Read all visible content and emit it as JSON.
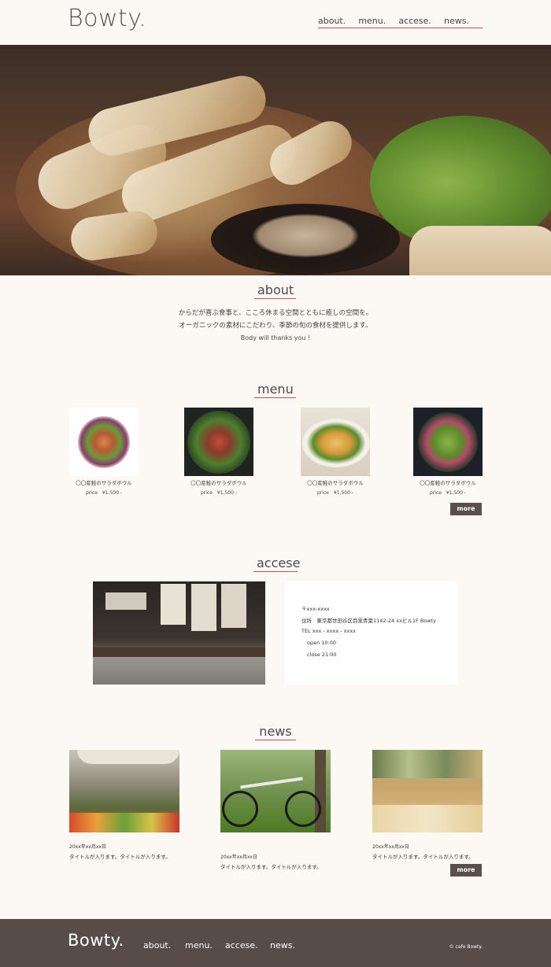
{
  "header": {
    "logo": "Bowty.",
    "nav": [
      "about.",
      "menu.",
      "accese.",
      "news."
    ]
  },
  "hero": {
    "alt": "Grilled shrimp platter with dip and salad"
  },
  "about": {
    "title": "about",
    "line1": "からだが喜ぶ食事と、こころ休まる空間とともに癒しの空間を。",
    "line2": "オーガニックの素材にこだわり、季節の旬の食材を提供します。",
    "line3": "Body will thanks you !"
  },
  "menu": {
    "title": "menu",
    "items": [
      {
        "name": "〇〇産鮭のサラダボウル",
        "price": "price　¥1,500 -"
      },
      {
        "name": "〇〇産鮭のサラダボウル",
        "price": "price　¥1,500 -"
      },
      {
        "name": "〇〇産鮭のサラダボウル",
        "price": "price　¥1,500 -"
      },
      {
        "name": "〇〇産鮭のサラダボウル",
        "price": "price　¥1,500 -"
      }
    ],
    "more": "more"
  },
  "access": {
    "title": "accese",
    "postal": "〒xxx-xxxx",
    "address": "住所　東京都世田谷区目黒青葉1142-24 xxビル1F Bowty",
    "tel": "TEL xxx - xxxx - xxxx",
    "open": "open 10:00",
    "close": "close 21:00"
  },
  "news": {
    "title": "news",
    "items": [
      {
        "date": "20xx年xx月xx日",
        "title": "タイトルが入ります。タイトルが入ります。"
      },
      {
        "date": "20xx年xx月xx日",
        "title": "タイトルが入ります。タイトルが入ります。"
      },
      {
        "date": "20xx年xx月xx日",
        "title": "タイトルが入ります。タイトルが入ります。"
      }
    ],
    "more": "more"
  },
  "footer": {
    "logo": "Bowty.",
    "nav": [
      "about.",
      "menu.",
      "accese.",
      "news."
    ],
    "copyright": "© cafe Bowty."
  },
  "colors": {
    "background": "#fcf9f4",
    "accent": "#c94a5c",
    "footer": "#574c48",
    "button": "#5a4f4a"
  }
}
